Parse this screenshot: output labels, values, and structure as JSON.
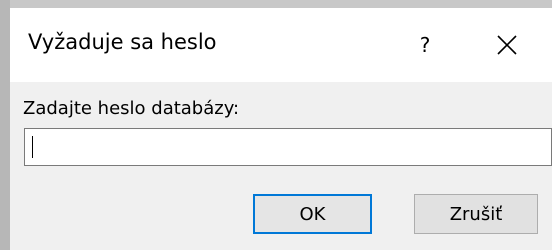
{
  "dialog": {
    "title": "Vyžaduje sa heslo",
    "help_label": "?",
    "prompt": "Zadajte heslo databázy:",
    "password_value": "",
    "ok_label": "OK",
    "cancel_label": "Zrušiť"
  },
  "icons": {
    "close": "close-icon"
  },
  "colors": {
    "dialog_background": "#f0f0f0",
    "titlebar_background": "#ffffff",
    "default_button_border": "#0078d7"
  }
}
